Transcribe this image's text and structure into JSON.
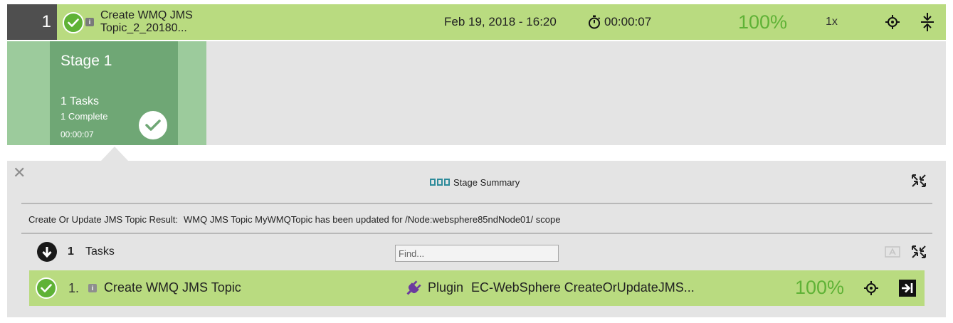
{
  "pipeline": {
    "run_number": "1",
    "title_line1": "Create WMQ JMS",
    "title_line2": "Topic_2_20180...",
    "date": "Feb 19, 2018 - 16:20",
    "duration": "00:00:07",
    "percent": "100%",
    "multiplier": "1x",
    "status": "success"
  },
  "stage": {
    "name": "Stage 1",
    "tasks": "1 Tasks",
    "complete": "1 Complete",
    "duration": "00:00:07"
  },
  "summary": {
    "title": "Stage Summary",
    "result_label": "Create Or Update JMS Topic Result:",
    "result_value": "WMQ JMS Topic MyWMQTopic has been updated for /Node:websphere85ndNode01/ scope",
    "tasks_count": "1",
    "tasks_label": "Tasks",
    "find_placeholder": "Find..."
  },
  "tasks": [
    {
      "number": "1.",
      "name": "Create WMQ JMS Topic",
      "type": "Plugin",
      "procedure": "EC-WebSphere CreateOrUpdateJMS...",
      "percent": "100%",
      "status": "success"
    }
  ],
  "icons": {
    "status_check": "check-circle-icon",
    "info": "info-icon",
    "stopwatch": "stopwatch-icon",
    "target": "crosshair-icon",
    "collapse": "collapse-vertical-icon",
    "close": "close-icon",
    "stage_summary": "three-squares-icon",
    "expand": "expand-arrows-icon",
    "down": "arrow-down-circle-icon",
    "sort": "sort-az-icon",
    "plugin": "plug-icon",
    "goto": "arrow-right-box-icon"
  },
  "colors": {
    "success_bar": "#b9db80",
    "success_green": "#5fb236",
    "stage_card": "#6fa775",
    "stage_band": "#9ccb9c",
    "panel_bg": "#e4e4e4",
    "run_number_bg": "#4f4f4f",
    "plugin_purple": "#6b3a9e",
    "summary_accent": "#2e8b9a"
  }
}
